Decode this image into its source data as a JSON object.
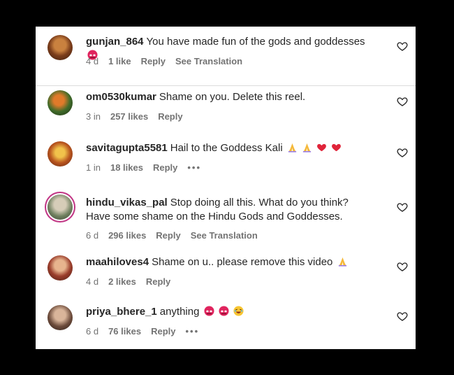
{
  "comments": [
    {
      "username": "gunjan_864",
      "text": "You have made fun of the gods and goddesses",
      "time": "4 d",
      "likes": "1 like",
      "reply": "Reply",
      "extra": "See Translation"
    },
    {
      "username": "om0530kumar",
      "text": "Shame on you. Delete this reel.",
      "time": "3 in",
      "likes": "257 likes",
      "reply": "Reply"
    },
    {
      "username": "savitagupta5581",
      "text": "Hail to the Goddess Kali",
      "time": "1 in",
      "likes": "18 likes",
      "reply": "Reply",
      "extra": "•••"
    },
    {
      "username": "hindu_vikas_pal",
      "text": "Stop doing all this. What do you think? Have some shame on the Hindu Gods and Goddesses.",
      "time": "6 d",
      "likes": "296 likes",
      "reply": "Reply",
      "extra": "See Translation"
    },
    {
      "username": "maahiloves4",
      "text": "Shame on u.. please remove this video",
      "time": "4 d",
      "likes": "2 likes",
      "reply": "Reply"
    },
    {
      "username": "priya_bhere_1",
      "text": "anything",
      "time": "6 d",
      "likes": "76 likes",
      "reply": "Reply",
      "extra": "•••"
    }
  ],
  "icons": {
    "like": "heart-outline-icon",
    "more": "ellipsis-icon"
  },
  "colors": {
    "background": "#000000",
    "panel": "#ffffff",
    "text": "#262626",
    "meta": "#737373",
    "story_ring": "#c13584"
  }
}
